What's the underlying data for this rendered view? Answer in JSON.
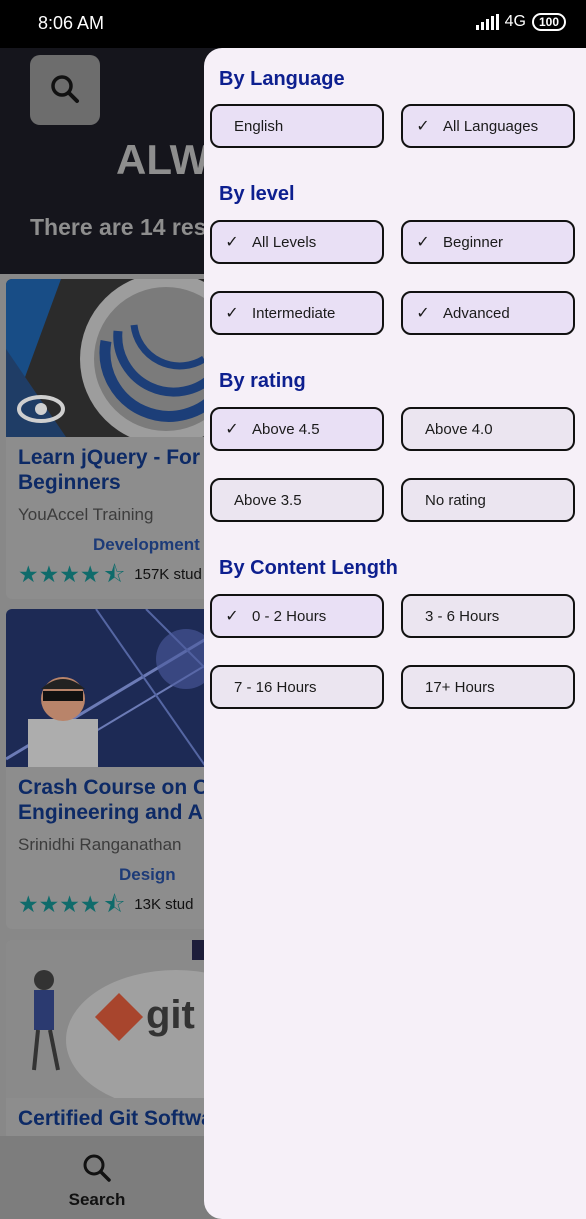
{
  "status_bar": {
    "time": "8:06 AM",
    "network": "4G",
    "battery": "100"
  },
  "background": {
    "title": "ALW",
    "results_text": "There are 14 res",
    "cards": [
      {
        "title": "Learn jQuery - For Beginners",
        "author": "YouAccel Training",
        "category": "Development",
        "rating": 4.5,
        "students": "157K stud"
      },
      {
        "title": "Crash Course on Civ Engineering and Aut",
        "author": "Srinidhi Ranganathan",
        "category": "Design",
        "rating": 4.5,
        "students": "13K stud"
      },
      {
        "title": "Certified Git Softwa",
        "thumb_text": "git"
      }
    ],
    "nav_search_label": "Search"
  },
  "drawer": {
    "sections": [
      {
        "title": "By Language",
        "chips": [
          {
            "label": "English",
            "checked": false
          },
          {
            "label": "All Languages",
            "checked": true
          }
        ]
      },
      {
        "title": "By level",
        "chips": [
          {
            "label": "All Levels",
            "checked": true
          },
          {
            "label": "Beginner",
            "checked": true
          },
          {
            "label": "Intermediate",
            "checked": true
          },
          {
            "label": "Advanced",
            "checked": true
          }
        ]
      },
      {
        "title": "By rating",
        "chips": [
          {
            "label": "Above 4.5",
            "checked": true
          },
          {
            "label": "Above 4.0",
            "checked": false
          },
          {
            "label": "Above 3.5",
            "checked": false
          },
          {
            "label": "No rating",
            "checked": false
          }
        ]
      },
      {
        "title": "By Content Length",
        "chips": [
          {
            "label": "0 - 2 Hours",
            "checked": true
          },
          {
            "label": "3 - 6 Hours",
            "checked": false
          },
          {
            "label": "7 - 16 Hours",
            "checked": false
          },
          {
            "label": "17+ Hours",
            "checked": false
          }
        ]
      }
    ]
  }
}
